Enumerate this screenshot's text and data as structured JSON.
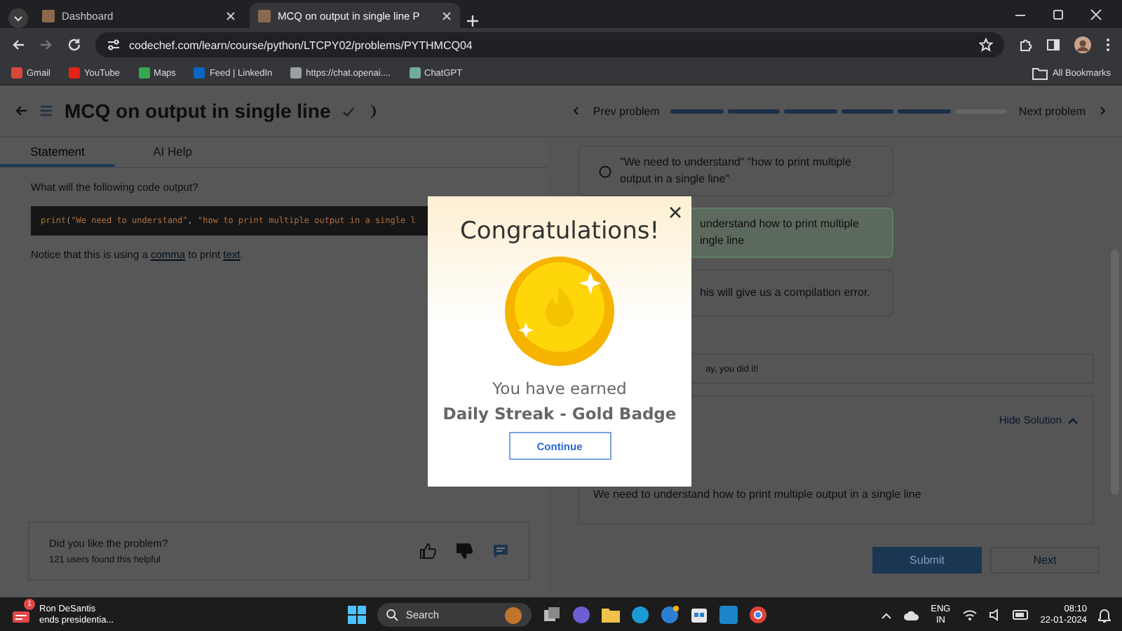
{
  "browser": {
    "tabs": [
      {
        "title": "Dashboard",
        "selected": false
      },
      {
        "title": "MCQ on output in single line P",
        "selected": true
      }
    ],
    "url": "codechef.com/learn/course/python/LTCPY02/problems/PYTHMCQ04",
    "bookmarks": [
      {
        "label": "Gmail",
        "color": "#d9473b"
      },
      {
        "label": "YouTube",
        "color": "#e62117"
      },
      {
        "label": "Maps",
        "color": "#34a853"
      },
      {
        "label": "Feed | LinkedIn",
        "color": "#0a66c2"
      },
      {
        "label": "https://chat.openai....",
        "color": "#9aa0a6"
      },
      {
        "label": "ChatGPT",
        "color": "#74aa9c"
      }
    ],
    "all_bookmarks": "All Bookmarks"
  },
  "header": {
    "title": "MCQ on output in single line",
    "prev": "Prev problem",
    "next": "Next problem",
    "progress": [
      {
        "done": true
      },
      {
        "done": true
      },
      {
        "done": true
      },
      {
        "done": true
      },
      {
        "done": true
      },
      {
        "done": false
      }
    ]
  },
  "tabs": [
    {
      "label": "Statement",
      "selected": true
    },
    {
      "label": "AI Help",
      "selected": false
    }
  ],
  "statement": {
    "question": "What will the following code output?",
    "code": [
      {
        "kind": "keyword",
        "text": "print"
      },
      {
        "kind": "punct",
        "text": "("
      },
      {
        "kind": "string",
        "text": "\"We need to understand\""
      },
      {
        "kind": "punct",
        "text": ", "
      },
      {
        "kind": "string",
        "text": "\"how to print multiple output in a single l"
      }
    ],
    "note": [
      {
        "kind": "text",
        "text": "Notice that this is using a "
      },
      {
        "kind": "link",
        "text": "comma"
      },
      {
        "kind": "text",
        "text": " to print "
      },
      {
        "kind": "link",
        "text": "text"
      },
      {
        "kind": "text",
        "text": "."
      }
    ]
  },
  "feedback": {
    "question": "Did you like the problem?",
    "count": "121 users found this helpful"
  },
  "options": [
    {
      "lines": [
        "\"We need to understand\" \"how to print multiple",
        "output in a single line\""
      ],
      "covered": false,
      "correct": false
    },
    {
      "lines": [
        "understand how to print multiple",
        "ingle line"
      ],
      "covered": true,
      "correct": true
    },
    {
      "lines": [
        "his will give us a compilation error."
      ],
      "covered": true,
      "correct": false
    }
  ],
  "result": "ay, you did it!",
  "solution": {
    "toggle": "Hide Solution",
    "text": "We need to understand how to print multiple output in a single line"
  },
  "buttons": {
    "submit": "Submit",
    "next": "Next"
  },
  "modal": {
    "title": "Congratulations!",
    "line": "You have earned",
    "badge": "Daily Streak - Gold Badge",
    "button": "Continue"
  },
  "taskbar": {
    "news_title": "Ron DeSantis",
    "news_subtitle": "ends presidentia...",
    "news_badge": "1",
    "search": "Search",
    "lang": "ENG",
    "region": "IN",
    "time": "08:10",
    "date": "22-01-2024"
  }
}
